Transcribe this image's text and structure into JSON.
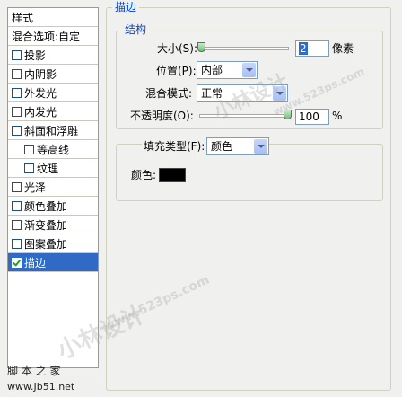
{
  "styles_panel": {
    "header": "样式",
    "blend_options": "混合选项:自定",
    "items": [
      {
        "label": "投影",
        "checked": false
      },
      {
        "label": "内阴影",
        "checked": false
      },
      {
        "label": "外发光",
        "checked": false
      },
      {
        "label": "内发光",
        "checked": false
      },
      {
        "label": "斜面和浮雕",
        "checked": false
      },
      {
        "label": "等高线",
        "checked": false
      },
      {
        "label": "纹理",
        "checked": false
      },
      {
        "label": "光泽",
        "checked": false
      },
      {
        "label": "颜色叠加",
        "checked": false
      },
      {
        "label": "渐变叠加",
        "checked": false
      },
      {
        "label": "图案叠加",
        "checked": false
      },
      {
        "label": "描边",
        "checked": true
      }
    ]
  },
  "stroke": {
    "section_title": "描边",
    "structure_title": "结构",
    "size_label": "大小(S):",
    "size_value": "2",
    "size_unit": "像素",
    "position_label": "位置(P):",
    "position_value": "内部",
    "blend_mode_label": "混合模式:",
    "blend_mode_value": "正常",
    "opacity_label": "不透明度(O):",
    "opacity_value": "100",
    "opacity_unit": "%",
    "opacity_level": 1.0,
    "size_level": 0.0,
    "fill_type_label": "填充类型(F):",
    "fill_type_value": "颜色",
    "color_label": "颜色:",
    "color_value": "#000000"
  },
  "watermarks": {
    "site1": "小林设计",
    "site1_url": "www.523ps.com",
    "site2": "脚 本 之 家",
    "site2_url": "www.Jb51.net"
  }
}
